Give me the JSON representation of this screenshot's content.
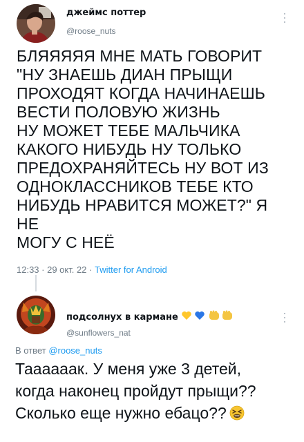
{
  "tweet": {
    "display_name": "джеймс поттер",
    "handle": "@roose_nuts",
    "text": "БЛЯЯЯЯЯ МНЕ МАТЬ ГОВОРИТ\n\"НУ ЗНАЕШЬ ДИАН ПРЫЩИ\nПРОХОДЯТ КОГДА НАЧИНАЕШЬ\nВЕСТИ ПОЛОВУЮ ЖИЗНЬ\nНУ МОЖЕТ ТЕБЕ МАЛЬЧИКА\nКАКОГО НИБУДЬ НУ ТОЛЬКО\nПРЕДОХРАНЯЙТЕСЬ НУ ВОТ ИЗ\nОДНОКЛАССНИКОВ ТЕБЕ КТО\nНИБУДЬ НРАВИТСЯ МОЖЕТ?\" Я НЕ\nМОГУ С НЕЁ",
    "time": "12:33 · 29 окт. 22 · ",
    "source": "Twitter for Android",
    "avatar_icon": "profile-photo",
    "more_icon": "more-vertical-icon"
  },
  "reply": {
    "display_name": "подсолнух в кармане",
    "name_emoji": [
      "yellow-heart",
      "blue-heart",
      "yellow-raised-fist",
      "yellow-raised-fist"
    ],
    "handle": "@sunflowers_nat",
    "reply_prefix": "В ответ ",
    "reply_to": "@roose_nuts",
    "text": "Таааааак. У меня уже 3 детей,\nкогда наконец пройдут прыщи??\nСколько еще нужно ебацо??",
    "end_emoji": "tired-face",
    "avatar_icon": "profile-photo",
    "more_icon": "more-vertical-icon"
  },
  "colors": {
    "text": "#0f1419",
    "secondary": "#6e7b86",
    "link": "#1d9bf0",
    "thread_line": "#d6dbe0",
    "heart_yellow": "#ffc72c",
    "heart_blue": "#2b77e6"
  }
}
